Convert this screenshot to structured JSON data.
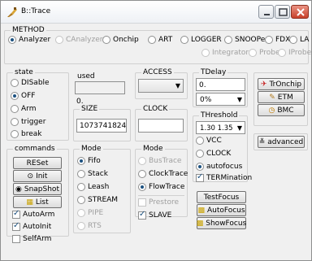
{
  "window": {
    "title": "B::Trace",
    "icon": "trace-icon",
    "controls": [
      "minimize",
      "maximize",
      "close"
    ]
  },
  "method": {
    "label": "METHOD",
    "row1": [
      {
        "label": "Analyzer",
        "selected": true,
        "enabled": true
      },
      {
        "label": "CAnalyzer",
        "selected": false,
        "enabled": false
      },
      {
        "label": "Onchip",
        "selected": false,
        "enabled": true
      },
      {
        "label": "ART",
        "selected": false,
        "enabled": true
      },
      {
        "label": "LOGGER",
        "selected": false,
        "enabled": true
      },
      {
        "label": "SNOOPer",
        "selected": false,
        "enabled": true
      },
      {
        "label": "FDX",
        "selected": false,
        "enabled": true
      },
      {
        "label": "LA",
        "selected": false,
        "enabled": true
      }
    ],
    "row2": [
      {
        "label": "Integrator",
        "selected": false,
        "enabled": false
      },
      {
        "label": "Probe",
        "selected": false,
        "enabled": false
      },
      {
        "label": "IProbe",
        "selected": false,
        "enabled": false
      }
    ]
  },
  "state": {
    "label": "state",
    "options": [
      {
        "label": "DISable",
        "selected": false
      },
      {
        "label": "OFF",
        "selected": true
      },
      {
        "label": "Arm",
        "selected": false
      },
      {
        "label": "trigger",
        "selected": false
      },
      {
        "label": "break",
        "selected": false
      }
    ]
  },
  "used": {
    "label": "used",
    "value": "0."
  },
  "size": {
    "label": "SIZE",
    "value": "1073741824."
  },
  "access": {
    "label": "ACCESS",
    "value": ""
  },
  "clock": {
    "label": "CLOCK",
    "value": ""
  },
  "tdelay": {
    "label": "TDelay",
    "value": "0.",
    "percent": "0%"
  },
  "right_buttons": {
    "tronchip": "TrOnchip",
    "etm": "ETM",
    "bmc": "BMC",
    "advanced": "advanced"
  },
  "commands": {
    "label": "commands",
    "reset": "RESet",
    "init": "Init",
    "snapshot": "SnapShot",
    "list": "List",
    "checks": [
      {
        "label": "AutoArm",
        "checked": true
      },
      {
        "label": "AutoInit",
        "checked": true
      },
      {
        "label": "SelfArm",
        "checked": false
      }
    ]
  },
  "mode1": {
    "label": "Mode",
    "options": [
      {
        "label": "Fifo",
        "selected": true,
        "enabled": true
      },
      {
        "label": "Stack",
        "selected": false,
        "enabled": true
      },
      {
        "label": "Leash",
        "selected": false,
        "enabled": true
      },
      {
        "label": "STREAM",
        "selected": false,
        "enabled": true
      },
      {
        "label": "PIPE",
        "selected": false,
        "enabled": false
      },
      {
        "label": "RTS",
        "selected": false,
        "enabled": false
      }
    ]
  },
  "mode2": {
    "label": "Mode",
    "options": [
      {
        "label": "BusTrace",
        "selected": false,
        "enabled": false
      },
      {
        "label": "ClockTrace",
        "selected": false,
        "enabled": true
      },
      {
        "label": "FlowTrace",
        "selected": true,
        "enabled": true
      }
    ],
    "checks": [
      {
        "label": "Prestore",
        "checked": false,
        "enabled": false
      },
      {
        "label": "SLAVE",
        "checked": true,
        "enabled": true
      }
    ]
  },
  "threshold": {
    "label": "THreshold",
    "value": "1.30 1.35",
    "options": [
      {
        "label": "VCC",
        "selected": false
      },
      {
        "label": "CLOCK",
        "selected": false
      },
      {
        "label": "autofocus",
        "selected": true
      }
    ],
    "termination": {
      "label": "TERMination",
      "checked": true
    },
    "testfocus": "TestFocus",
    "autofocus_btn": "AutoFocus",
    "showfocus": "ShowFocus"
  }
}
